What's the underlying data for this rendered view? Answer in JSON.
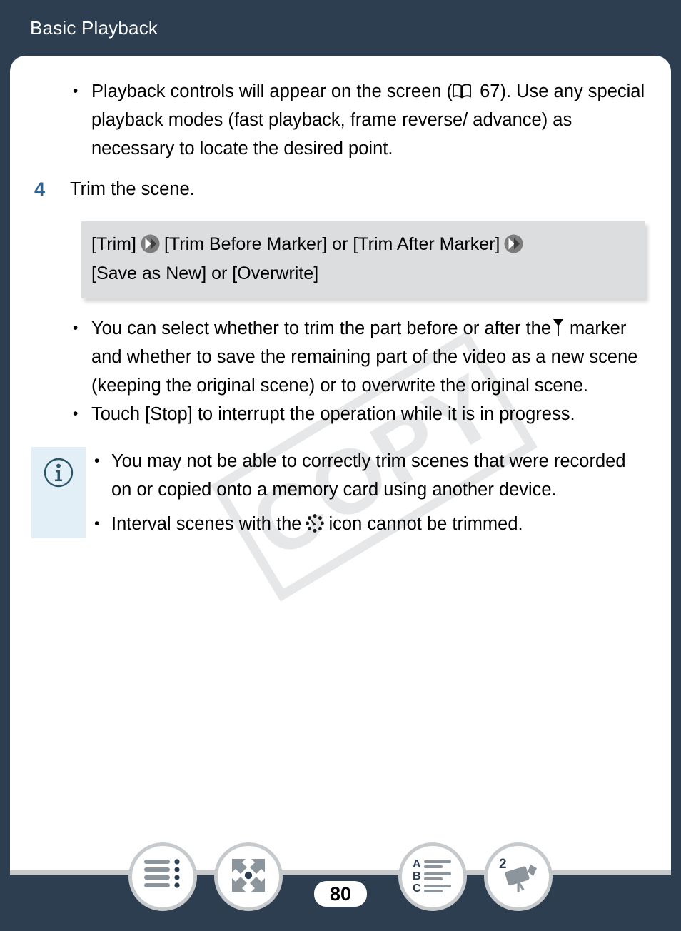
{
  "header": {
    "title": "Basic Playback"
  },
  "content": {
    "top_bullets": [
      {
        "before_icon": "Playback controls will appear on the screen (",
        "icon": "book-icon",
        "after_icon": " 67). Use any special playback modes (fast playback, frame reverse/ advance) as necessary to locate the desired point."
      }
    ],
    "step": {
      "number": "4",
      "text": "Trim the scene."
    },
    "menu_box": {
      "line1_part1": "[Trim]",
      "line1_part2": "[Trim Before Marker] or [Trim After Marker]",
      "line2": "[Save as New] or [Overwrite]",
      "arrow_icon": "double-chevron-right-icon"
    },
    "mid_bullets": [
      {
        "part1": "You can select whether to trim the part before or after the",
        "icon": "marker-icon",
        "part2": "marker and whether to save the remaining part of the video as a new scene (keeping the original scene) or to overwrite the original scene."
      },
      {
        "part1": "Touch [Stop] to interrupt the operation while it is in progress.",
        "icon": "",
        "part2": ""
      }
    ],
    "note": {
      "icon": "info-icon",
      "bullets": [
        {
          "part1": "You may not be able to correctly trim scenes that were recorded on or copied onto a memory card using another device.",
          "icon": "",
          "part2": ""
        },
        {
          "part1": "Interval scenes with the",
          "icon": "interval-recording-icon",
          "part2": "icon cannot be trimmed."
        }
      ]
    },
    "watermark": "COPY"
  },
  "footer": {
    "page_number": "80",
    "buttons": [
      {
        "name": "table-of-contents-button",
        "icon": "list-lines-dots-icon",
        "label": ""
      },
      {
        "name": "functions-index-button",
        "icon": "four-arrows-expand-icon",
        "label": ""
      },
      {
        "name": "alphabetical-index-button",
        "icon": "abc-list-icon",
        "label": ""
      },
      {
        "name": "camcorder-index-button",
        "icon": "camcorder-tripod-icon",
        "label": "2"
      }
    ],
    "camcorder_badge": "2",
    "abc_letters": [
      "A",
      "B",
      "C"
    ]
  },
  "colors": {
    "page_background": "#2d3e50",
    "card_background": "#ffffff",
    "step_number": "#2a6496",
    "menu_box_background": "#dcdddf",
    "note_strip": "#e2eff7",
    "footer_rule": "#c6cacd",
    "icon_gray": "#8d959c",
    "watermark": "#e6e7e8"
  }
}
